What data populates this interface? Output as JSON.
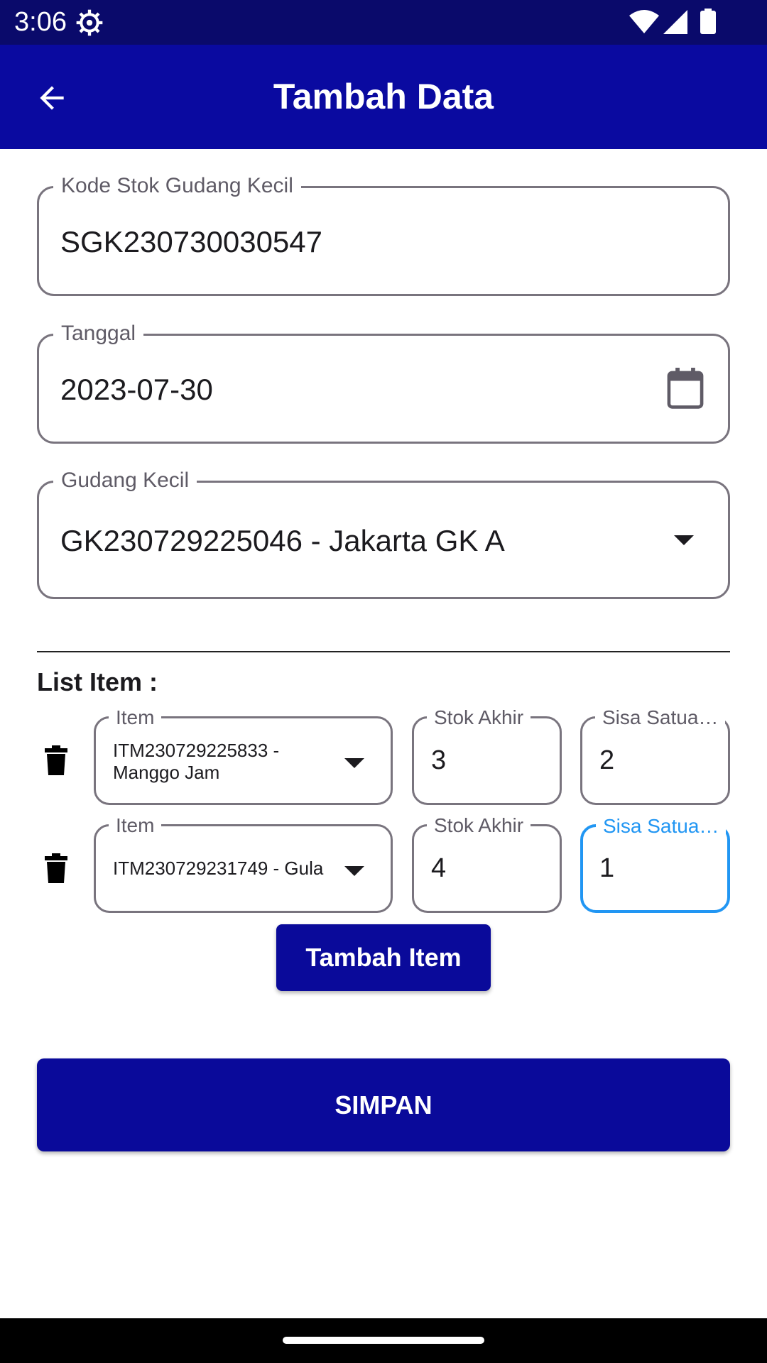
{
  "status_bar": {
    "time": "3:06"
  },
  "app_bar": {
    "title": "Tambah Data"
  },
  "form": {
    "kode": {
      "label": "Kode Stok Gudang Kecil",
      "value": "SGK230730030547"
    },
    "tanggal": {
      "label": "Tanggal",
      "value": "2023-07-30"
    },
    "gudang": {
      "label": "Gudang Kecil",
      "value": "GK230729225046 - Jakarta GK A"
    }
  },
  "list": {
    "title": "List Item :",
    "rows": [
      {
        "item_label": "Item",
        "item_value_line1": "ITM230729225833 -",
        "item_value_line2": "Manggo Jam",
        "stok_label": "Stok Akhir",
        "stok_value": "3",
        "sisa_label": "Sisa Satua…",
        "sisa_value": "2"
      },
      {
        "item_label": "Item",
        "item_value_line1": "ITM230729231749 - Gula",
        "stok_label": "Stok Akhir",
        "stok_value": "4",
        "sisa_label": "Sisa Satua…",
        "sisa_value": "1"
      }
    ]
  },
  "buttons": {
    "add_item": "Tambah Item",
    "save": "SIMPAN"
  },
  "colors": {
    "status_bar": "#0a0a6b",
    "app_bar": "#0a0aa0",
    "button": "#0a0a9a",
    "focus": "#2196f3"
  }
}
